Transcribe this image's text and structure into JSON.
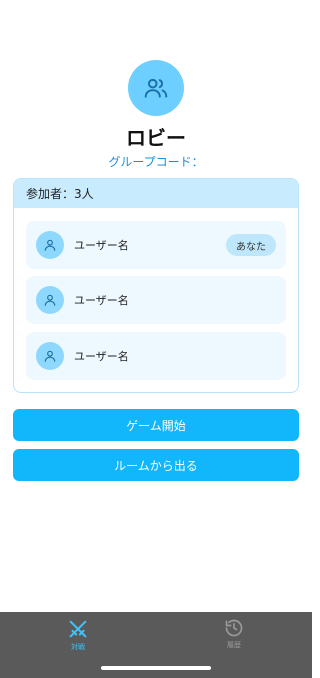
{
  "lobby": {
    "icon": "users-icon",
    "title": "ロビー",
    "group_code_label": "グループコード："
  },
  "participants": {
    "header": "参加者：3人",
    "users": [
      {
        "name": "ユーザー名",
        "badge": "あなた",
        "avatar_icon": "user-icon"
      },
      {
        "name": "ユーザー名",
        "avatar_icon": "user-icon"
      },
      {
        "name": "ユーザー名",
        "avatar_icon": "user-icon"
      }
    ]
  },
  "actions": {
    "start_game": "ゲーム開始",
    "leave_room": "ルームから出る"
  },
  "tab_bar": {
    "tabs": [
      {
        "label": "対戦",
        "icon": "crossed-swords-icon",
        "active": true
      },
      {
        "label": "履歴",
        "icon": "history-icon",
        "active": false
      }
    ]
  },
  "colors": {
    "accent": "#11b6fb",
    "accent_light": "#6ccfff",
    "link_text": "#1a8fd9",
    "tab_bar_bg": "#5a5a5a",
    "tab_active": "#3cc4ff",
    "tab_inactive": "#9a9a9a"
  }
}
